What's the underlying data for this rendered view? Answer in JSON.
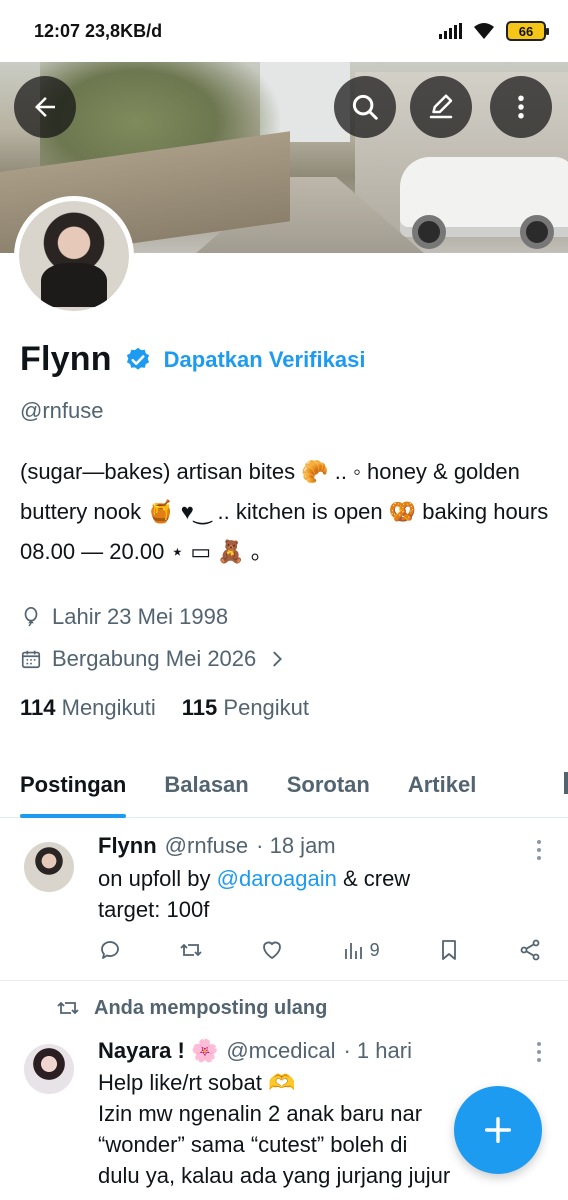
{
  "status_bar": {
    "time_speed": "12:07 23,8KB/d",
    "battery": "66"
  },
  "profile": {
    "name": "Flynn",
    "get_verified": "Dapatkan Verifikasi",
    "handle": "@rnfuse",
    "bio": "(sugar—bakes) artisan bites 🥐 .. ◦ honey & golden buttery nook 🍯 ♥‿ .. kitchen is open 🥨 baking hours 08.00 — 20.00 ⋆ ▭ 🧸 。",
    "birthday": "Lahir 23 Mei 1998",
    "joined": "Bergabung Mei 2026",
    "following_count": "114",
    "following_label": "Mengikuti",
    "followers_count": "115",
    "followers_label": "Pengikut"
  },
  "tabs": [
    {
      "label": "Postingan",
      "active": true
    },
    {
      "label": "Balasan",
      "active": false
    },
    {
      "label": "Sorotan",
      "active": false
    },
    {
      "label": "Artikel",
      "active": false
    }
  ],
  "posts": [
    {
      "name": "Flynn",
      "handle": "@rnfuse",
      "time": "· 18 jam",
      "text_prefix": "on upfoll by ",
      "mention": "@daroagain",
      "text_suffix": " & crew",
      "text_line2": "target: 100f",
      "views": "9"
    },
    {
      "repost_note": "Anda memposting ulang",
      "name": "Nayara ! 🌸",
      "handle": "@mcedical",
      "time": "· 1 hari",
      "lines": [
        "Help like/rt sobat 🫶",
        "Izin mw ngenalin 2 anak baru  nar",
        "“wonder” sama “cutest” boleh di",
        "dulu ya, kalau ada yang jurjang jujur"
      ]
    }
  ],
  "colors": {
    "accent": "#1d9bf0",
    "text": "#0f1419",
    "secondary": "#536471"
  }
}
